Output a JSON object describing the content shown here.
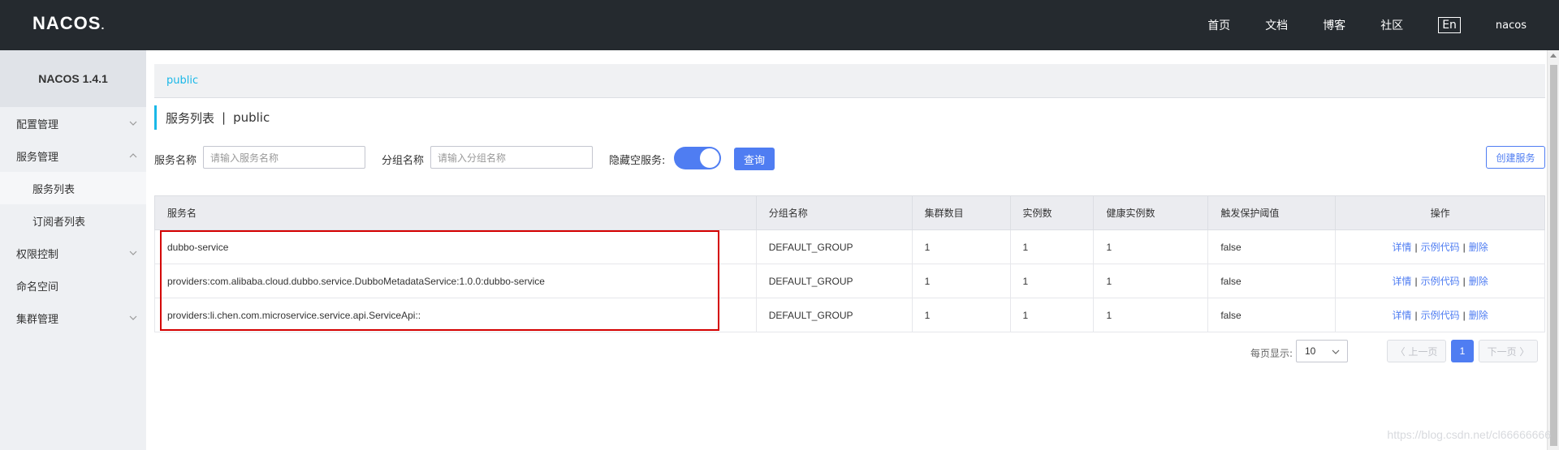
{
  "header": {
    "logo": "NACOS",
    "nav": [
      "首页",
      "文档",
      "博客",
      "社区"
    ],
    "lang": "En",
    "user": "nacos"
  },
  "sidebar": {
    "title": "NACOS 1.4.1",
    "items": [
      {
        "label": "配置管理",
        "chevron": "down"
      },
      {
        "label": "服务管理",
        "chevron": "up"
      },
      {
        "label": "服务列表",
        "sub": true,
        "active": true
      },
      {
        "label": "订阅者列表",
        "sub": true
      },
      {
        "label": "权限控制",
        "chevron": "down"
      },
      {
        "label": "命名空间"
      },
      {
        "label": "集群管理",
        "chevron": "down"
      }
    ]
  },
  "breadcrumb": "public",
  "page_title": {
    "main": "服务列表",
    "sep": "|",
    "ns": "public"
  },
  "filters": {
    "service_name_label": "服务名称",
    "service_name_placeholder": "请输入服务名称",
    "group_name_label": "分组名称",
    "group_name_placeholder": "请输入分组名称",
    "hide_empty_label": "隐藏空服务:",
    "hide_empty_on": true,
    "query_label": "查询",
    "create_label": "创建服务"
  },
  "table": {
    "columns": [
      "服务名",
      "分组名称",
      "集群数目",
      "实例数",
      "健康实例数",
      "触发保护阈值",
      "操作"
    ],
    "rows": [
      [
        "dubbo-service",
        "DEFAULT_GROUP",
        "1",
        "1",
        "1",
        "false"
      ],
      [
        "providers:com.alibaba.cloud.dubbo.service.DubboMetadataService:1.0.0:dubbo-service",
        "DEFAULT_GROUP",
        "1",
        "1",
        "1",
        "false"
      ],
      [
        "providers:li.chen.com.microservice.service.api.ServiceApi::",
        "DEFAULT_GROUP",
        "1",
        "1",
        "1",
        "false"
      ]
    ],
    "actions": {
      "detail": "详情",
      "sample": "示例代码",
      "delete": "删除",
      "sep": "|"
    }
  },
  "pagination": {
    "per_page_label": "每页显示:",
    "per_page": "10",
    "prev": "〈 上一页",
    "next": "下一页 〉",
    "current": "1"
  },
  "watermark": "https://blog.csdn.net/cl66666666",
  "colors": {
    "accent": "#4f7df2",
    "header_bg": "#252a2f",
    "link": "#1ab8e8",
    "highlight": "#d40000"
  }
}
